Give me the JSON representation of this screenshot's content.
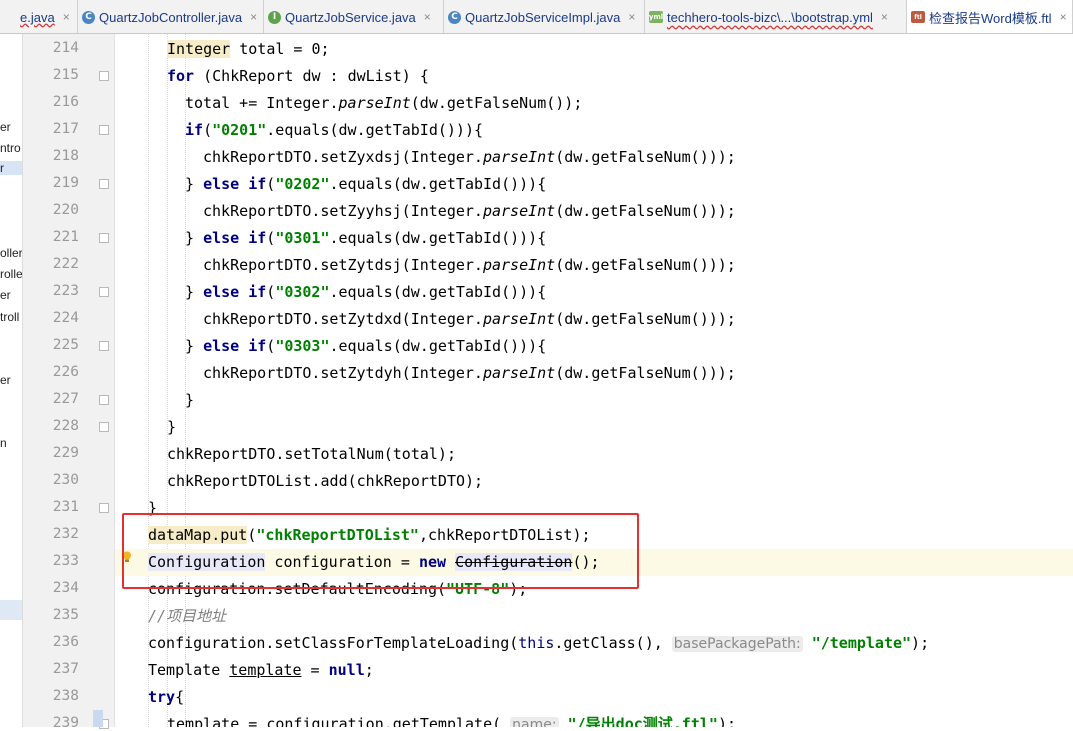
{
  "tabs": [
    {
      "label": "e.java",
      "icon": "none",
      "active": false
    },
    {
      "label": "QuartzJobController.java",
      "icon": "class-icon",
      "active": false
    },
    {
      "label": "QuartzJobService.java",
      "icon": "interface-icon",
      "active": false
    },
    {
      "label": "QuartzJobServiceImpl.java",
      "icon": "class-icon",
      "active": false
    },
    {
      "label": "techhero-tools-bizc\\...\\bootstrap.yml",
      "icon": "yaml-icon",
      "active": false
    },
    {
      "label": "检查报告Word模板.ftl",
      "icon": "ftl-icon",
      "active": false
    }
  ],
  "tab_close": "×",
  "sidebar_fragments": [
    "er",
    "ntro",
    "r",
    "oller",
    "rolle",
    "er",
    "troll",
    "er",
    "n"
  ],
  "lines": [
    {
      "n": "214",
      "t": "Integer total = 0;"
    },
    {
      "n": "215",
      "t": "for (ChkReport dw : dwList) {"
    },
    {
      "n": "216",
      "t": "total += Integer.parseInt(dw.getFalseNum());"
    },
    {
      "n": "217",
      "t": "if(\"0201\".equals(dw.getTabId())){"
    },
    {
      "n": "218",
      "t": "chkReportDTO.setZyxdsj(Integer.parseInt(dw.getFalseNum()));"
    },
    {
      "n": "219",
      "t": "} else if(\"0202\".equals(dw.getTabId())){"
    },
    {
      "n": "220",
      "t": "chkReportDTO.setZyyhsj(Integer.parseInt(dw.getFalseNum()));"
    },
    {
      "n": "221",
      "t": "} else if(\"0301\".equals(dw.getTabId())){"
    },
    {
      "n": "222",
      "t": "chkReportDTO.setZytdsj(Integer.parseInt(dw.getFalseNum()));"
    },
    {
      "n": "223",
      "t": "} else if(\"0302\".equals(dw.getTabId())){"
    },
    {
      "n": "224",
      "t": "chkReportDTO.setZytdxd(Integer.parseInt(dw.getFalseNum()));"
    },
    {
      "n": "225",
      "t": "} else if(\"0303\".equals(dw.getTabId())){"
    },
    {
      "n": "226",
      "t": "chkReportDTO.setZytdyh(Integer.parseInt(dw.getFalseNum()));"
    },
    {
      "n": "227",
      "t": "}"
    },
    {
      "n": "228",
      "t": "}"
    },
    {
      "n": "229",
      "t": "chkReportDTO.setTotalNum(total);"
    },
    {
      "n": "230",
      "t": "chkReportDTOList.add(chkReportDTO);"
    },
    {
      "n": "231",
      "t": "}"
    },
    {
      "n": "232",
      "t": "dataMap.put(\"chkReportDTOList\",chkReportDTOList);"
    },
    {
      "n": "233",
      "t": "Configuration configuration = new Configuration();"
    },
    {
      "n": "234",
      "t": "configuration.setDefaultEncoding(\"UTF-8\");"
    },
    {
      "n": "235",
      "t": "//项目地址"
    },
    {
      "n": "236",
      "t": "configuration.setClassForTemplateLoading(this.getClass(), basePackagePath: \"/template\");"
    },
    {
      "n": "237",
      "t": "Template template = null;"
    },
    {
      "n": "238",
      "t": "try{"
    },
    {
      "n": "239",
      "t": "template = configuration.getTemplate( name: \"/导出doc测试.ftl\");"
    }
  ],
  "colors": {
    "keyword": "#000080",
    "string": "#008000",
    "comment": "#808080",
    "annotation_box": "#e53030",
    "current_line": "#fcfae4"
  }
}
